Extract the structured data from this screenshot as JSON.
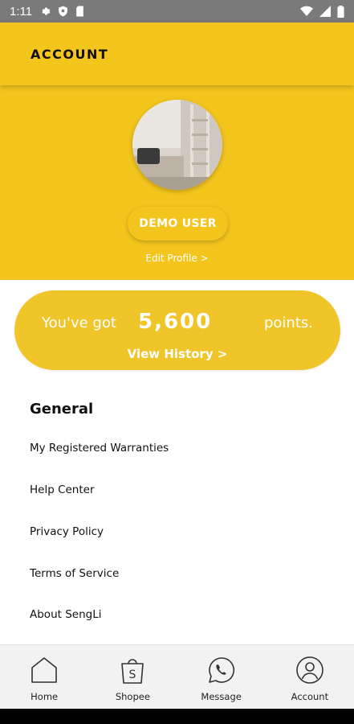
{
  "status_bar": {
    "time": "1:11",
    "left_icons": [
      "gear-icon",
      "shield-icon",
      "sd-card-icon"
    ],
    "right_icons": [
      "wifi-icon",
      "signal-icon",
      "battery-icon"
    ]
  },
  "header": {
    "title": "ACCOUNT"
  },
  "profile": {
    "name": "DEMO USER",
    "edit_label": "Edit Profile >"
  },
  "points": {
    "prefix": "You've got",
    "value": "5,600",
    "suffix": "points.",
    "history_label": "View History >"
  },
  "general": {
    "heading": "General",
    "items": [
      "My Registered Warranties",
      "Help Center",
      "Privacy Policy",
      "Terms of Service",
      "About SengLi"
    ]
  },
  "bottom_nav": {
    "items": [
      {
        "label": "Home",
        "icon": "home-icon"
      },
      {
        "label": "Shopee",
        "icon": "shopping-bag-icon"
      },
      {
        "label": "Message",
        "icon": "whatsapp-icon"
      },
      {
        "label": "Account",
        "icon": "user-icon"
      }
    ]
  },
  "colors": {
    "brand_yellow": "#f3c51d",
    "status_bar": "#7a7a7a"
  }
}
